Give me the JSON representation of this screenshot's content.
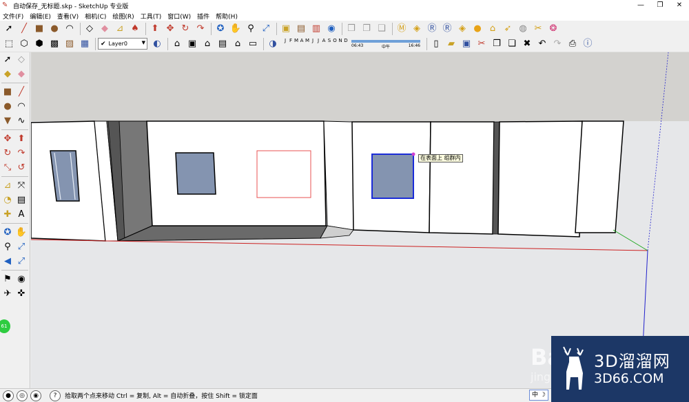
{
  "window": {
    "title": "自动保存_无标题.skp - SketchUp 专业版",
    "controls": {
      "minimize": "—",
      "maximize": "❐",
      "close": "✕"
    }
  },
  "menu": [
    "文件(F)",
    "编辑(E)",
    "查看(V)",
    "相机(C)",
    "绘图(R)",
    "工具(T)",
    "窗口(W)",
    "插件",
    "帮助(H)"
  ],
  "toolbar": {
    "layer": "Layer0",
    "months": [
      "J",
      "F",
      "M",
      "A",
      "M",
      "J",
      "J",
      "A",
      "S",
      "O",
      "N",
      "D"
    ],
    "time_start": "06:43",
    "time_mid": "中午",
    "time_end": "16:46"
  },
  "viewport": {
    "tooltip": "在表面上 组群内",
    "colors": {
      "sky": "#d3d2cf",
      "ground": "#e6e7e9",
      "wall": "#ffffff",
      "window_fill": "#8494b0",
      "selected": "#1a2bd8",
      "rect_outline": "#e85050",
      "axis_red": "#cc2020",
      "axis_green": "#22aa22",
      "axis_blue": "#2020cc"
    }
  },
  "badge": "61",
  "status": {
    "text": "拾取两个点来移动 Ctrl = 复制, Alt = 自动折叠，按住 Shift = 锁定面",
    "ime": "中 ☽"
  },
  "watermark": {
    "brand": "3D溜溜网",
    "url": "3D66.COM",
    "baidu": "Ba",
    "baidu_sub": "jing"
  }
}
